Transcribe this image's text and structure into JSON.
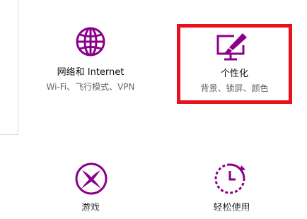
{
  "accent_color": "#8b008b",
  "highlight_color": "#e8111b",
  "tiles": [
    {
      "title": "网络和 Internet",
      "subtitle": "Wi-Fi、飞行模式、VPN",
      "icon": "globe-icon"
    },
    {
      "title": "个性化",
      "subtitle": "背景、锁屏、颜色",
      "icon": "monitor-paintbrush-icon",
      "highlighted": true
    },
    {
      "title": "游戏",
      "subtitle": "",
      "icon": "xbox-icon"
    },
    {
      "title": "轻松使用",
      "subtitle": "",
      "icon": "clock-icon"
    }
  ]
}
